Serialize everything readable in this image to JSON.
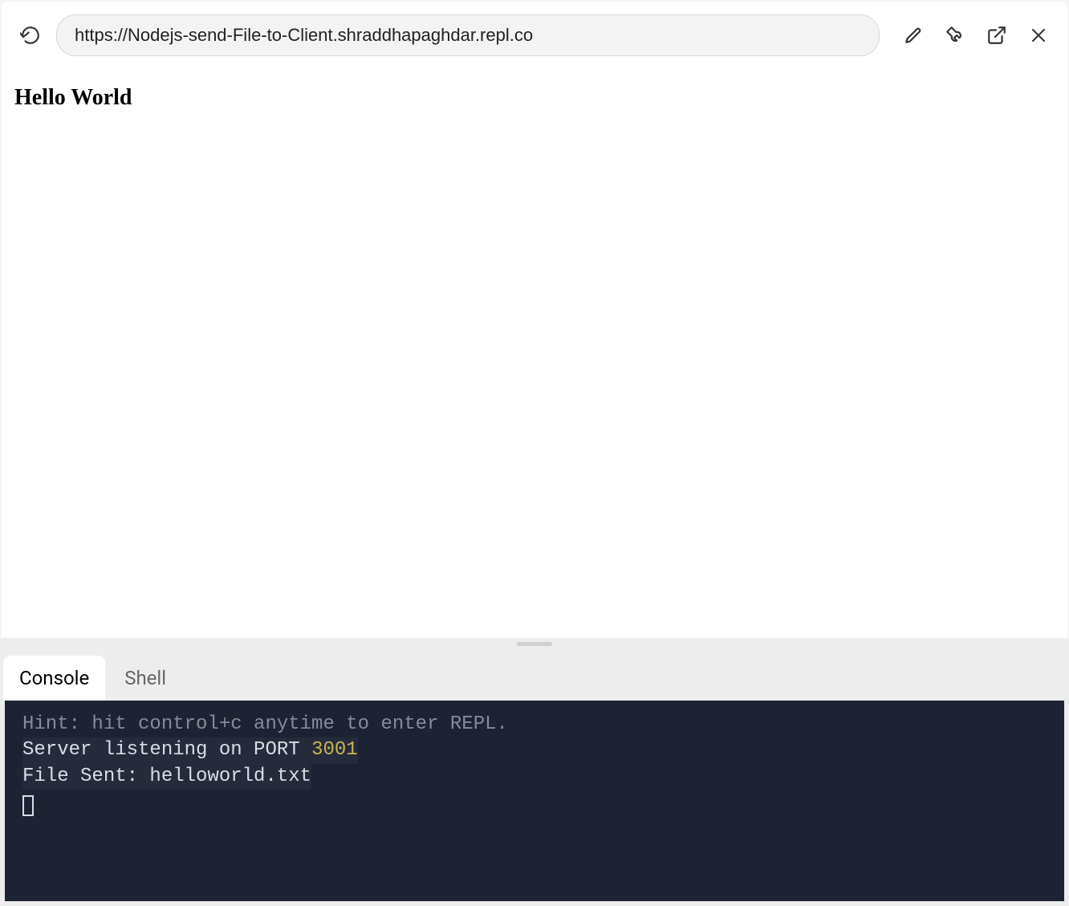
{
  "browser": {
    "url": "https://Nodejs-send-File-to-Client.shraddhapaghdar.repl.co",
    "page_content": "Hello World"
  },
  "bottom_panel": {
    "tabs": [
      {
        "label": "Console",
        "active": true
      },
      {
        "label": "Shell",
        "active": false
      }
    ],
    "console": {
      "hint": "Hint: hit control+c anytime to enter REPL.",
      "line1_prefix": "Server listening on PORT ",
      "line1_port": "3001",
      "line2": "File Sent: helloworld.txt"
    }
  }
}
